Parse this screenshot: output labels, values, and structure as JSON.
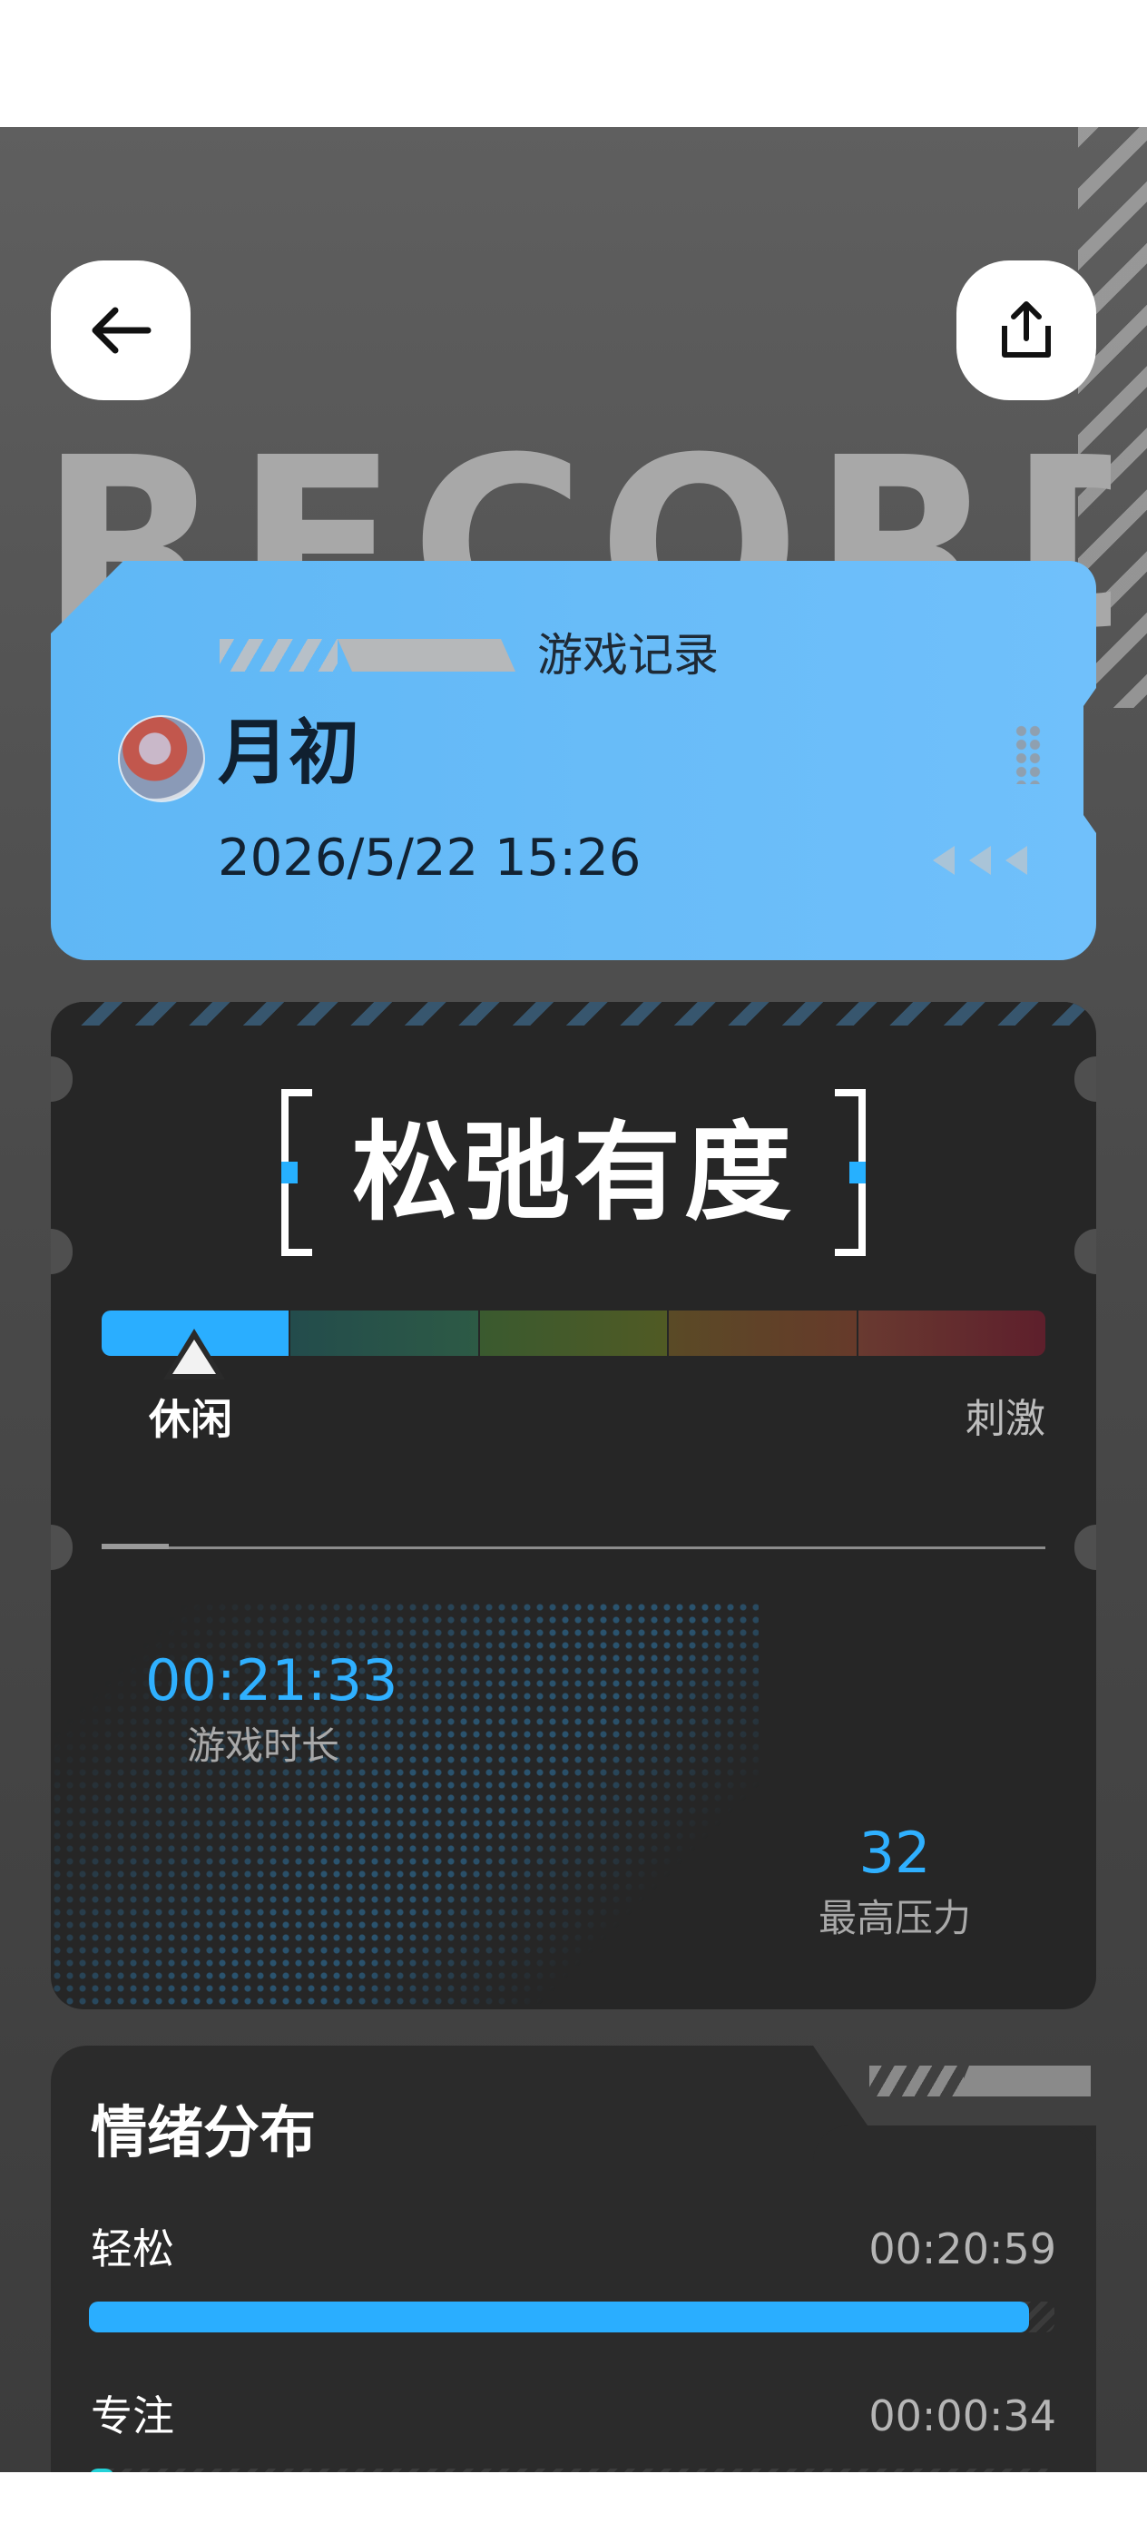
{
  "header": {
    "background_word": "RECORD",
    "back_icon": "arrow-left-icon",
    "share_icon": "share-icon"
  },
  "record_card": {
    "title": "游戏记录",
    "player_name": "月初",
    "datetime": "2026/5/22 15:26",
    "accent_color": "#6EBFFA"
  },
  "mood_summary": {
    "mood_level": "松弛有度",
    "scale_min_label": "休闲",
    "scale_max_label": "刺激",
    "scale_position": 0.1,
    "duration_value": "00:21:33",
    "duration_label": "游戏时长",
    "max_pressure_value": "32",
    "max_pressure_label": "最高压力",
    "highlight_color": "#2AAEFF"
  },
  "emotion_distribution": {
    "title": "情绪分布",
    "rows": [
      {
        "label": "轻松",
        "time": "00:20:59",
        "fraction": 0.974,
        "color": "#2AAEFF"
      },
      {
        "label": "专注",
        "time": "00:00:34",
        "fraction": 0.026,
        "color": "#24D2D8"
      }
    ]
  }
}
